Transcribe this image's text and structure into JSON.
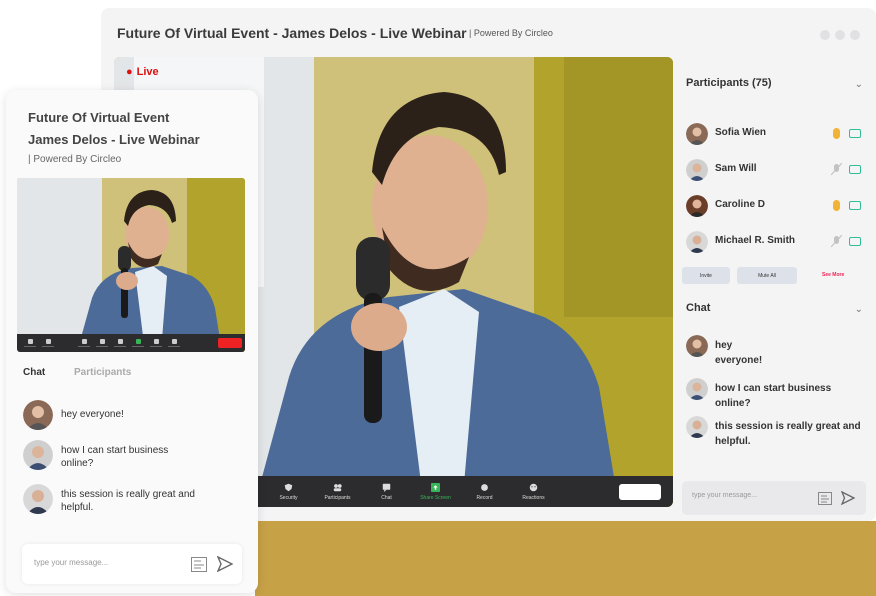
{
  "desktop": {
    "title": "Future Of Virtual Event - James Delos - Live Webinar",
    "powered": "| Powered By Circleo",
    "live_label": "Live",
    "toolbar": [
      {
        "label": "Security",
        "icon": "shield-icon"
      },
      {
        "label": "Participants",
        "icon": "people-icon"
      },
      {
        "label": "Chat",
        "icon": "chat-icon"
      },
      {
        "label": "Share Screen",
        "icon": "share-screen-icon"
      },
      {
        "label": "Record",
        "icon": "record-icon"
      },
      {
        "label": "Reactions",
        "icon": "reactions-icon"
      }
    ],
    "participants_header": "Participants (75)",
    "participants": [
      {
        "name": "Sofia Wien",
        "mic": "on"
      },
      {
        "name": "Sam Will",
        "mic": "muted"
      },
      {
        "name": "Caroline D",
        "mic": "on"
      },
      {
        "name": "Michael R. Smith",
        "mic": "muted"
      }
    ],
    "invite_label": "Invite",
    "mute_all_label": "Mute All",
    "see_more_label": "See More",
    "chat_header": "Chat",
    "messages": [
      {
        "text": "hey everyone!"
      },
      {
        "text": "how I can start business online?"
      },
      {
        "text": "this session is really great and helpful."
      }
    ],
    "input_placeholder": "type your message..."
  },
  "mobile": {
    "title_line1": "Future Of Virtual Event",
    "title_line2": "James Delos - Live Webinar",
    "powered": "| Powered By Circleo",
    "tabs": [
      "Chat",
      "Participants"
    ],
    "messages": [
      {
        "text": "hey everyone!"
      },
      {
        "text": "how I can start business online?"
      },
      {
        "text": "this session is really great and helpful."
      }
    ],
    "input_placeholder": "type your message..."
  },
  "colors": {
    "accent_green": "#38b558",
    "live_red": "#dd1111",
    "mic_on": "#f2b233",
    "band_gold": "#c7a146"
  }
}
